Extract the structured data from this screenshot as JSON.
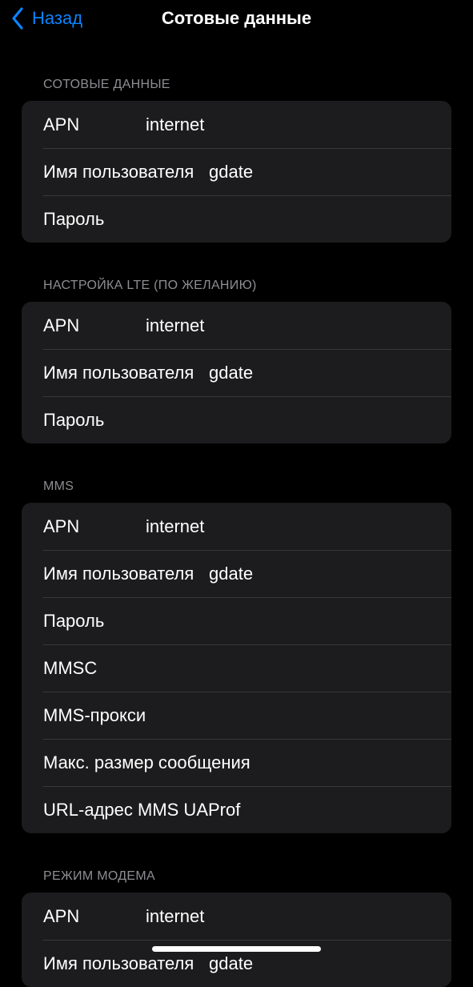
{
  "nav": {
    "back_label": "Назад",
    "title": "Сотовые данные"
  },
  "sections": [
    {
      "header": "СОТОВЫЕ ДАННЫЕ",
      "rows": [
        {
          "label": "APN",
          "value": "internet"
        },
        {
          "label": "Имя пользователя",
          "value": "gdate"
        },
        {
          "label": "Пароль",
          "value": ""
        }
      ]
    },
    {
      "header": "НАСТРОЙКА LTE (ПО ЖЕЛАНИЮ)",
      "rows": [
        {
          "label": "APN",
          "value": "internet"
        },
        {
          "label": "Имя пользователя",
          "value": "gdate"
        },
        {
          "label": "Пароль",
          "value": ""
        }
      ]
    },
    {
      "header": "MMS",
      "rows": [
        {
          "label": "APN",
          "value": "internet"
        },
        {
          "label": "Имя пользователя",
          "value": "gdate"
        },
        {
          "label": "Пароль",
          "value": ""
        },
        {
          "label": "MMSC",
          "value": ""
        },
        {
          "label": "MMS-прокси",
          "value": ""
        },
        {
          "label": "Макс. размер сообщения",
          "value": ""
        },
        {
          "label": "URL-адрес MMS UAProf",
          "value": ""
        }
      ]
    },
    {
      "header": "РЕЖИМ МОДЕМА",
      "rows": [
        {
          "label": "APN",
          "value": "internet"
        },
        {
          "label": "Имя пользователя",
          "value": "gdate"
        }
      ]
    }
  ],
  "colors": {
    "background": "#000000",
    "group_background": "#1c1c1e",
    "accent": "#0a84ff",
    "section_header": "#8d8d93",
    "separator": "#38383a"
  },
  "icons": {
    "back": "chevron-left-icon"
  }
}
